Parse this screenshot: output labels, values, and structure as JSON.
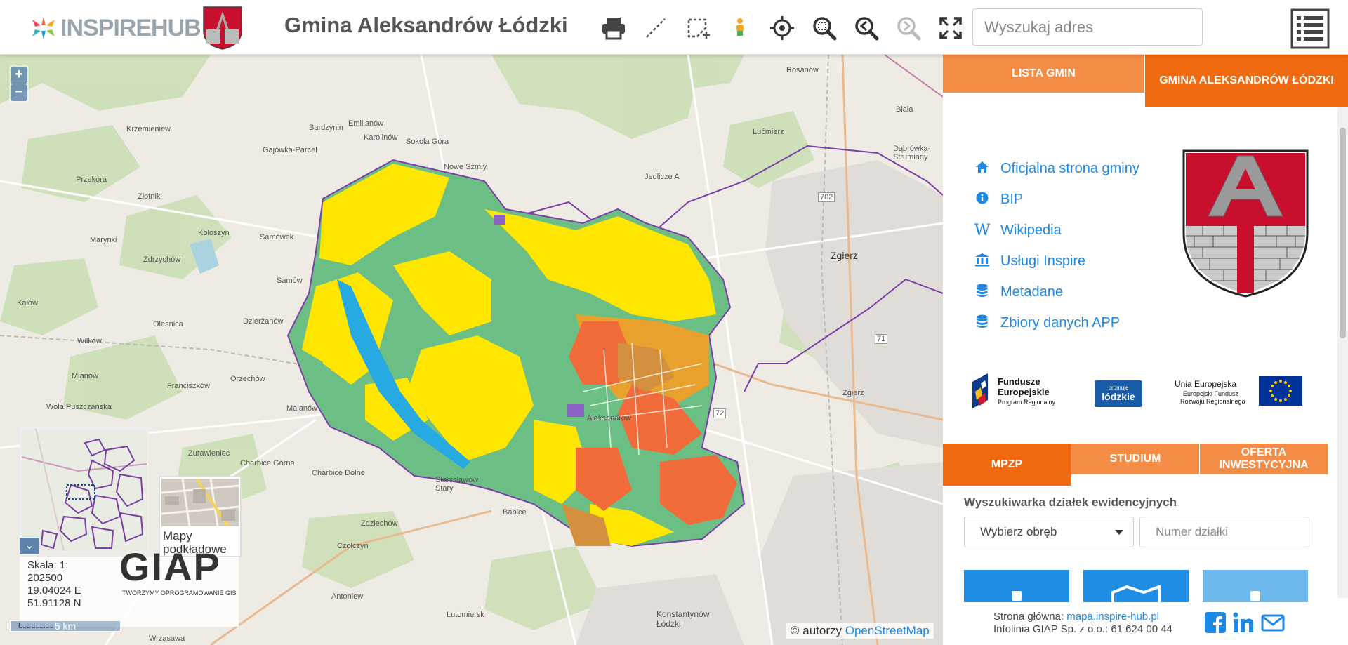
{
  "header": {
    "logo_text": "INSPIREHUB",
    "title": "Gmina Aleksandrów Łódzki",
    "search_placeholder": "Wyszukaj adres",
    "tools": [
      "print-icon",
      "measure-line-icon",
      "measure-area-icon",
      "street-view-icon",
      "locate-icon",
      "zoom-extent-icon",
      "zoom-previous-icon",
      "zoom-next-icon",
      "fullscreen-icon"
    ],
    "menu_icon": "list-menu-icon"
  },
  "map": {
    "zoom_in": "+",
    "zoom_out": "−",
    "basemaps_label": "Mapy podkładowe",
    "scale_label": "Skala: 1:",
    "scale_value": "202500",
    "lon": "19.04024 E",
    "lat": "51.91128 N",
    "giap_logo": "GIAP",
    "giap_tagline": "TWORZYMY OPROGRAMOWANIE GIS",
    "scalebar": "5 km",
    "attribution_prefix": "© autorzy",
    "attribution_link": "OpenStreetMap",
    "place_labels": [
      {
        "name": "Zgierz"
      },
      {
        "name": "Konstantynów Łódzki"
      },
      {
        "name": "Aleksandrów"
      },
      {
        "name": "Rosanów"
      },
      {
        "name": "Lućmierz"
      },
      {
        "name": "Jedlicze A"
      },
      {
        "name": "Nowe Szmiy"
      },
      {
        "name": "Sokola Góra"
      },
      {
        "name": "Karolinów"
      },
      {
        "name": "Emilianów"
      },
      {
        "name": "Bardzynin"
      },
      {
        "name": "Gajówka-Parcel"
      },
      {
        "name": "Samówek"
      },
      {
        "name": "Samów"
      },
      {
        "name": "Dzierżanów"
      },
      {
        "name": "Orzechów"
      },
      {
        "name": "Malanów"
      },
      {
        "name": "Charbice Dolne"
      },
      {
        "name": "Charbice Górne"
      },
      {
        "name": "Babice"
      },
      {
        "name": "Czołczyn"
      },
      {
        "name": "Antoniew"
      },
      {
        "name": "Lutomiersk"
      },
      {
        "name": "Wilków"
      },
      {
        "name": "Mianów"
      },
      {
        "name": "Kałów"
      },
      {
        "name": "Olesnica"
      },
      {
        "name": "Zdrzychów"
      },
      {
        "name": "Marynki"
      },
      {
        "name": "Koloszyn"
      },
      {
        "name": "Złotniki"
      },
      {
        "name": "Przekora"
      },
      {
        "name": "Krzemieniew"
      },
      {
        "name": "Zgierz"
      },
      {
        "name": "Dąbrówka-Strumiany"
      },
      {
        "name": "Biała"
      },
      {
        "name": "Wola Puszczańska"
      },
      {
        "name": "Franciszków"
      },
      {
        "name": "Zurawieniec"
      },
      {
        "name": "Stanisławów Stary"
      },
      {
        "name": "Zdziechów"
      },
      {
        "name": "Łobudzice"
      },
      {
        "name": "Wrząsawa"
      }
    ],
    "road_numbers": [
      "702",
      "72",
      "71"
    ]
  },
  "panel": {
    "tabs_top": [
      {
        "label": "LISTA GMIN",
        "color": "#f58c45"
      },
      {
        "label": "GMINA ALEKSANDRÓW ŁÓDZKI",
        "color": "#f26a0f"
      }
    ],
    "links": [
      {
        "icon": "home-icon",
        "label": "Oficjalna strona gminy"
      },
      {
        "icon": "info-icon",
        "label": "BIP"
      },
      {
        "icon": "wikipedia-icon",
        "label": "Wikipedia"
      },
      {
        "icon": "institution-icon",
        "label": "Usługi Inspire"
      },
      {
        "icon": "database-icon",
        "label": "Metadane"
      },
      {
        "icon": "database-icon",
        "label": "Zbiory danych APP"
      }
    ],
    "logos": {
      "fe_title": "Fundusze Europejskie",
      "fe_sub": "Program Regionalny",
      "lodzkie": "łódzkie",
      "lodzkie_small": "promuje",
      "ue_title": "Unia Europejska",
      "ue_sub1": "Europejski Fundusz",
      "ue_sub2": "Rozwoju Regionalnego"
    },
    "tabs_bottom": [
      {
        "label": "MPZP",
        "color": "#f26a0f"
      },
      {
        "label": "STUDIUM",
        "color": "#f58c45"
      },
      {
        "label": "OFERTA INWESTYCYJNA",
        "color": "#f58c45"
      }
    ],
    "search_title": "Wyszukiwarka działek ewidencyjnych",
    "select_label": "Wybierz obręb",
    "parcel_placeholder": "Numer działki",
    "footer": {
      "line1_prefix": "Strona główna:",
      "line1_link": "mapa.inspire-hub.pl",
      "line2": "Infolinia GIAP Sp. z o.o.: 61 624 00 44"
    },
    "social": [
      "facebook-icon",
      "linkedin-icon",
      "envelope-icon"
    ]
  },
  "colors": {
    "accent": "#f26a0f",
    "accent_light": "#f58c45",
    "link": "#1e88e5",
    "boundary": "#7b3fa6"
  }
}
